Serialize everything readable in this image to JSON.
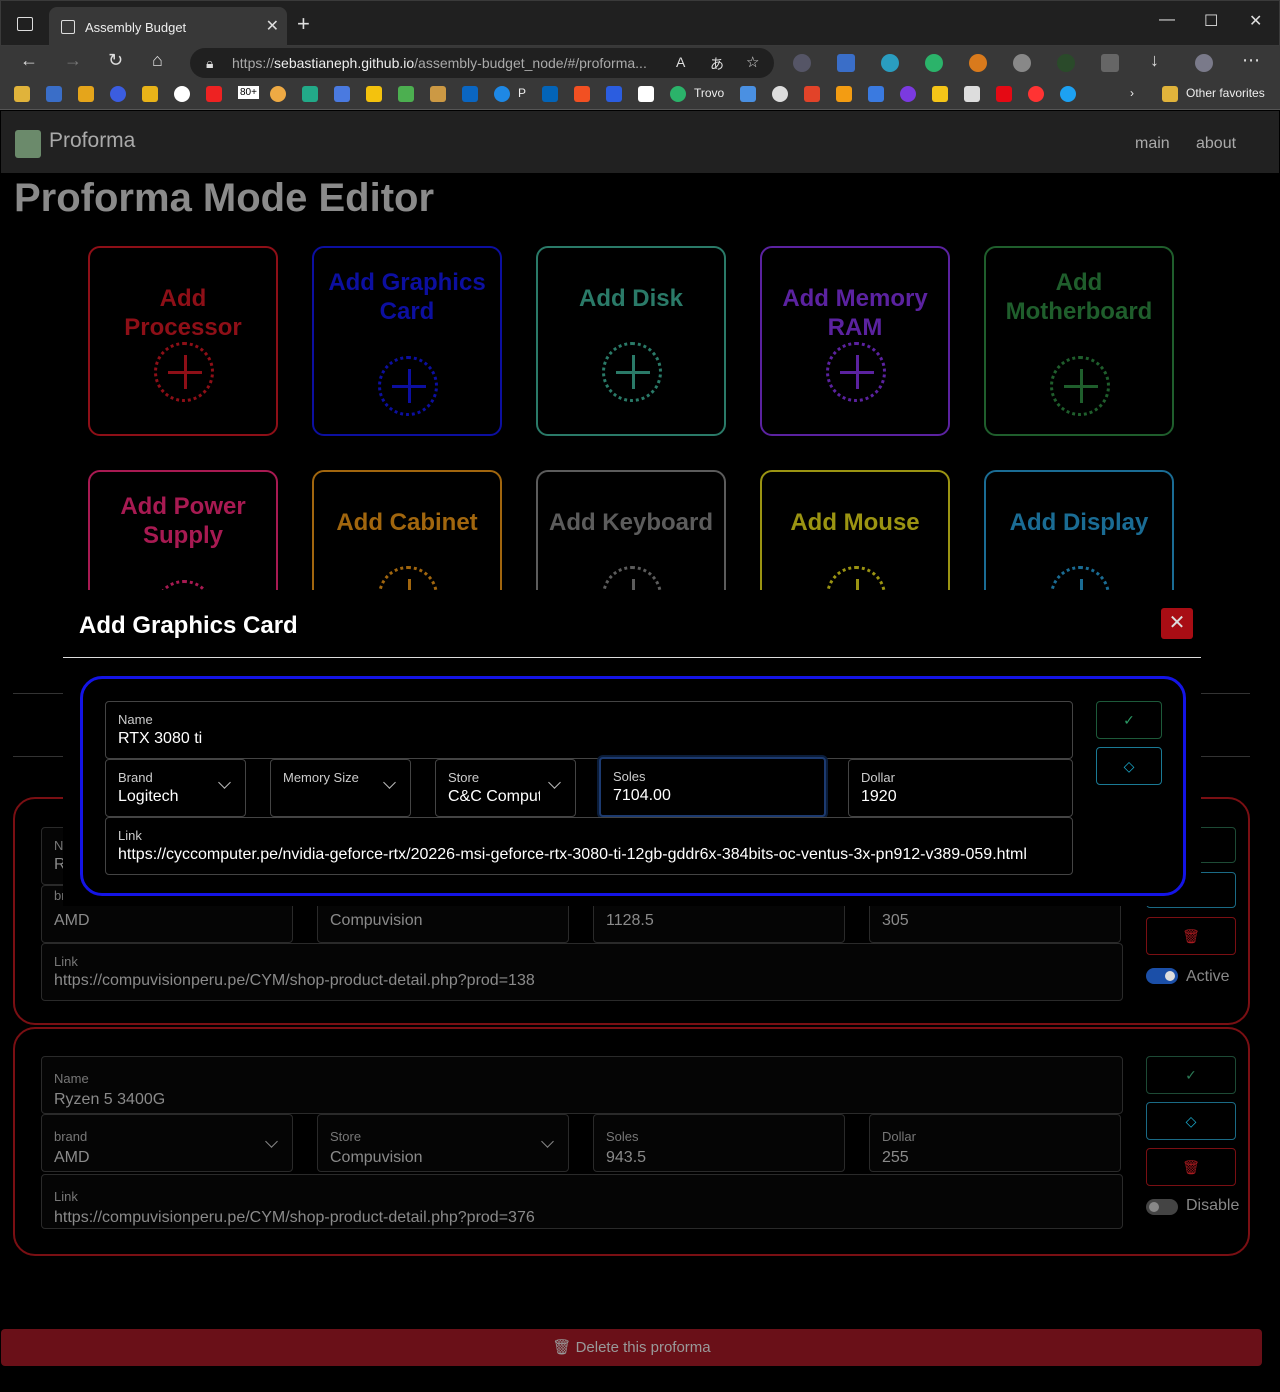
{
  "browser": {
    "tab_title": "Assembly Budget",
    "url_prefix": "https://",
    "url_host": "sebastianeph.github.io",
    "url_path": "/assembly-budget_node/#/proforma...",
    "bookmarks": {
      "p_label": "P",
      "trovo_label": "Trovo",
      "badge_label": "80+",
      "other_favorites": "Other favorites"
    }
  },
  "app": {
    "brand": "Proforma",
    "nav": {
      "main": "main",
      "about": "about"
    },
    "page_title": "Proforma Mode Editor"
  },
  "component_cards": [
    {
      "label": "Add Processor",
      "color": "#8e0f17"
    },
    {
      "label": "Add Graphics Card",
      "color": "#0c0fa0"
    },
    {
      "label": "Add Disk",
      "color": "#2a7a68"
    },
    {
      "label": "Add Memory RAM",
      "color": "#5b22a0"
    },
    {
      "label": "Add Motherboard",
      "color": "#1f5e2c"
    },
    {
      "label": "Add Power Supply",
      "color": "#a81a52"
    },
    {
      "label": "Add Cabinet",
      "color": "#a1660e"
    },
    {
      "label": "Add Keyboard",
      "color": "#5c5c5c"
    },
    {
      "label": "Add Mouse",
      "color": "#9b9412"
    },
    {
      "label": "Add Display",
      "color": "#1a6c94"
    }
  ],
  "list_items": [
    {
      "name_label": "Name",
      "name_value": "R",
      "brand_label": "brand",
      "brand_value": "AMD",
      "store_value": "Compuvision",
      "soles_value": "1128.5",
      "dollar_value": "305",
      "link_label": "Link",
      "link_value": "https://compuvisionperu.pe/CYM/shop-product-detail.php?prod=138",
      "status": "Active"
    },
    {
      "name_label": "Name",
      "name_value": "Ryzen 5 3400G",
      "brand_label": "brand",
      "brand_value": "AMD",
      "store_label": "Store",
      "store_value": "Compuvision",
      "soles_label": "Soles",
      "soles_value": "943.5",
      "dollar_label": "Dollar",
      "dollar_value": "255",
      "link_label": "Link",
      "link_value": "https://compuvisionperu.pe/CYM/shop-product-detail.php?prod=376",
      "status": "Disable"
    }
  ],
  "delete_label": "Delete this proforma",
  "modal": {
    "title": "Add Graphics Card",
    "close_glyph": "✕",
    "form": {
      "name": {
        "label": "Name",
        "value": "RTX 3080 ti"
      },
      "brand": {
        "label": "Brand",
        "value": "Logitech"
      },
      "memory_size": {
        "label": "Memory Size",
        "value": ""
      },
      "store": {
        "label": "Store",
        "value": "C&C Comput"
      },
      "soles": {
        "label": "Soles",
        "value": "7104.00"
      },
      "dollar": {
        "label": "Dollar",
        "value": "1920"
      },
      "link": {
        "label": "Link",
        "value": "https://cyccomputer.pe/nvidia-geforce-rtx/20226-msi-geforce-rtx-3080-ti-12gb-gddr6x-384bits-oc-ventus-3x-pn912-v389-059.html"
      }
    }
  },
  "colors": {
    "accent_red": "#7a0f13",
    "modal_border": "#1414e6",
    "confirm_green": "#2a7a55",
    "erase_cyan": "#1aa7c9"
  }
}
